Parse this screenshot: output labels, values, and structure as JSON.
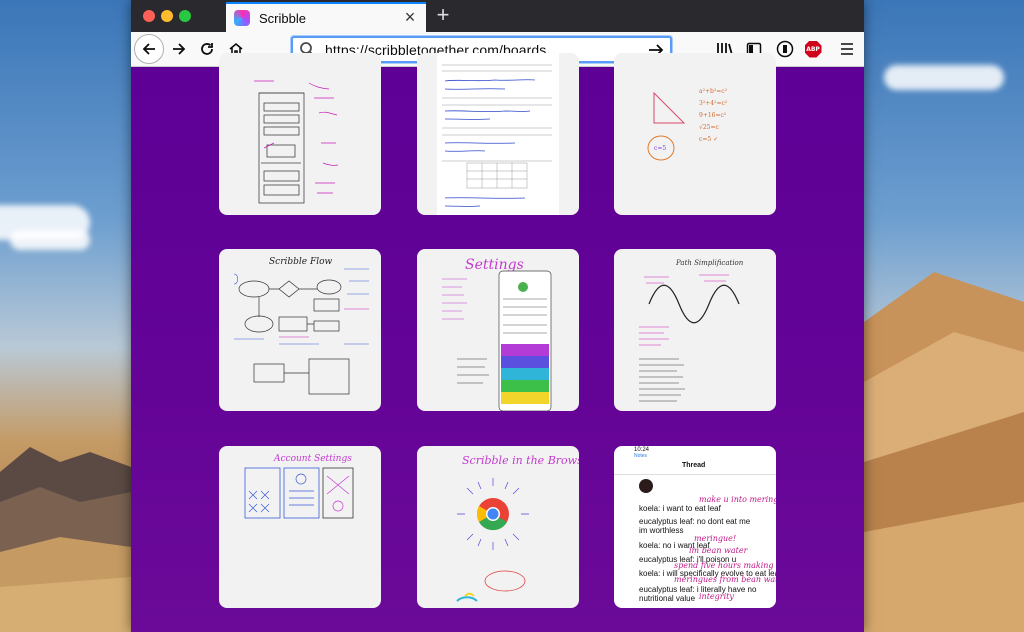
{
  "browser": {
    "tab_title": "Scribble",
    "url": "https://scribbletogether.com/boards",
    "adblock_label": "ABP"
  },
  "colors": {
    "accent": "#0a84ff",
    "board_bg": "#610497",
    "card_bg": "#f2f2f3"
  },
  "boards": [
    {
      "id": "board-1",
      "title": ""
    },
    {
      "id": "board-2",
      "title": ""
    },
    {
      "id": "board-3",
      "title": ""
    },
    {
      "id": "board-4",
      "title": "Scribble Flow"
    },
    {
      "id": "board-5",
      "title": "Settings"
    },
    {
      "id": "board-6",
      "title": "Path Simplification"
    },
    {
      "id": "board-7",
      "title": "Account Settings"
    },
    {
      "id": "board-8",
      "title": "Scribble in the Browser!"
    },
    {
      "id": "board-9",
      "title": "Thread"
    }
  ],
  "thread": {
    "time": "10:24",
    "back": "Notes",
    "title": "Thread",
    "lines": [
      "koela: i want to eat leaf",
      "eucalyptus leaf: no dont eat me im worthless",
      "koela: no i want leaf",
      "eucalyptus leaf: i'll poison u",
      "koela: i will specifically evolve to eat leaf",
      "eucalyptus leaf: i literally have no nutritional value"
    ],
    "hand": [
      "make u into meringue",
      "meringue!",
      "im bean water",
      "spend five hours making",
      "meringues from bean water",
      "integrity"
    ]
  }
}
